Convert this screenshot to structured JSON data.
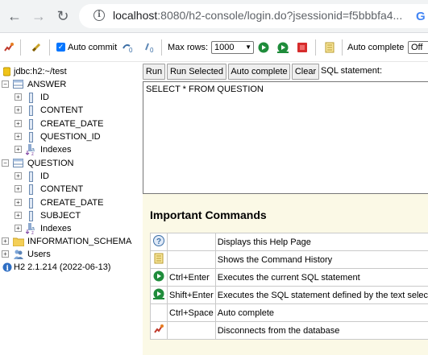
{
  "browser": {
    "url_host": "localhost",
    "url_rest": ":8080/h2-console/login.do?jsessionid=f5bbbfa4...",
    "search_icon": "G"
  },
  "toolbar": {
    "autocommit_label": "Auto commit",
    "autocommit_checked": true,
    "maxrows_label": "Max rows:",
    "maxrows_value": "1000",
    "autocomplete_label": "Auto complete",
    "autocomplete_value": "Off"
  },
  "tree": {
    "connection": "jdbc:h2:~/test",
    "tables": [
      {
        "name": "ANSWER",
        "columns": [
          "ID",
          "CONTENT",
          "CREATE_DATE",
          "QUESTION_ID"
        ],
        "indexes_label": "Indexes"
      },
      {
        "name": "QUESTION",
        "columns": [
          "ID",
          "CONTENT",
          "CREATE_DATE",
          "SUBJECT"
        ],
        "indexes_label": "Indexes"
      }
    ],
    "schema": "INFORMATION_SCHEMA",
    "users": "Users",
    "version": "H2 2.1.214 (2022-06-13)"
  },
  "sql": {
    "run_label": "Run",
    "run_selected_label": "Run Selected",
    "auto_complete_label": "Auto complete",
    "clear_label": "Clear",
    "statement_label": "SQL statement:",
    "query": "SELECT * FROM QUESTION"
  },
  "commands": {
    "title": "Important Commands",
    "rows": [
      {
        "icon": "help-icon",
        "key": "",
        "desc": "Displays this Help Page"
      },
      {
        "icon": "history-icon",
        "key": "",
        "desc": "Shows the Command History"
      },
      {
        "icon": "run-icon",
        "key": "Ctrl+Enter",
        "desc": "Executes the current SQL statement"
      },
      {
        "icon": "run-selected-icon",
        "key": "Shift+Enter",
        "desc": "Executes the SQL statement defined by the text selecti"
      },
      {
        "icon": "",
        "key": "Ctrl+Space",
        "desc": "Auto complete"
      },
      {
        "icon": "disconnect-icon",
        "key": "",
        "desc": "Disconnects from the database"
      }
    ]
  }
}
